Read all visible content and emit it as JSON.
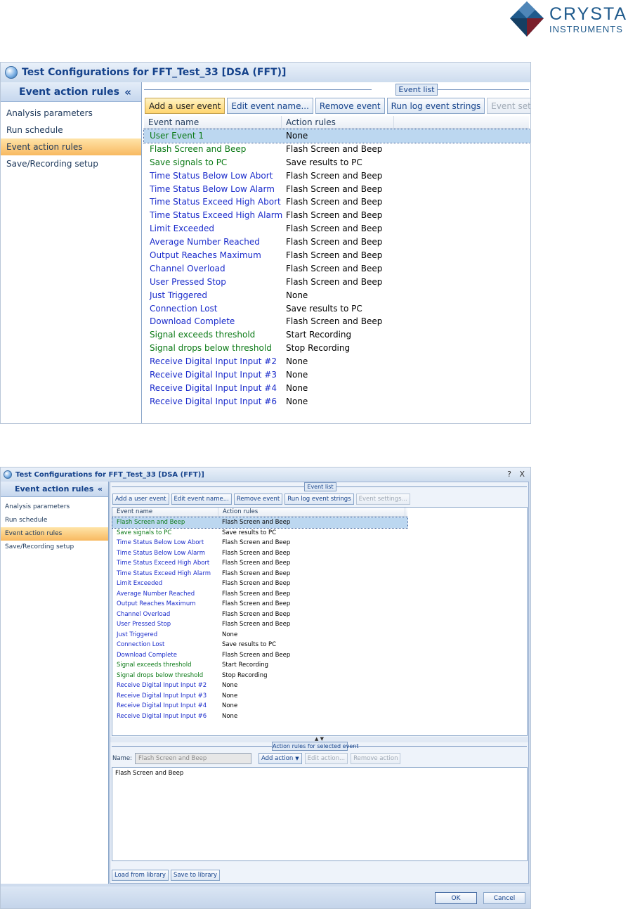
{
  "logo": {
    "line1": "CRYSTAL",
    "line2": "INSTRUMENTS",
    "colors": [
      "#1f5a8c",
      "#7a1f2b"
    ]
  },
  "window1": {
    "title": "Test Configurations for FFT_Test_33 [DSA (FFT)]",
    "sidebar": {
      "header": "Event action rules",
      "collapse_icon": "«",
      "items": [
        {
          "label": "Analysis parameters",
          "active": false
        },
        {
          "label": "Run schedule",
          "active": false
        },
        {
          "label": "Event action rules",
          "active": true
        },
        {
          "label": "Save/Recording setup",
          "active": false
        }
      ]
    },
    "group_title": "Event list",
    "toolbar": {
      "add": "Add a user event",
      "edit": "Edit event name...",
      "remove": "Remove event",
      "runlog": "Run log event strings",
      "settings": "Event settings..."
    },
    "columns": {
      "name": "Event name",
      "rules": "Action rules"
    },
    "rows": [
      {
        "name": "User Event 1",
        "rules": "None"
      },
      {
        "name": "Flash Screen and Beep",
        "rules": "Flash Screen and Beep"
      },
      {
        "name": "Save signals to PC",
        "rules": "Save results to PC"
      },
      {
        "name": "Time Status Below Low Abort",
        "rules": "Flash Screen and Beep"
      },
      {
        "name": "Time Status Below Low Alarm",
        "rules": "Flash Screen and Beep"
      },
      {
        "name": "Time Status Exceed High Abort",
        "rules": "Flash Screen and Beep"
      },
      {
        "name": "Time Status Exceed High Alarm",
        "rules": "Flash Screen and Beep"
      },
      {
        "name": "Limit Exceeded",
        "rules": "Flash Screen and Beep"
      },
      {
        "name": "Average Number Reached",
        "rules": "Flash Screen and Beep"
      },
      {
        "name": "Output Reaches Maximum",
        "rules": "Flash Screen and Beep"
      },
      {
        "name": "Channel Overload",
        "rules": "Flash Screen and Beep"
      },
      {
        "name": "User Pressed Stop",
        "rules": "Flash Screen and Beep"
      },
      {
        "name": "Just Triggered",
        "rules": "None"
      },
      {
        "name": "Connection Lost",
        "rules": "Save results to PC"
      },
      {
        "name": "Download Complete",
        "rules": "Flash Screen and Beep"
      },
      {
        "name": "Signal exceeds threshold",
        "rules": "Start Recording"
      },
      {
        "name": "Signal drops below threshold",
        "rules": "Stop Recording"
      },
      {
        "name": "Receive Digital Input Input #2",
        "rules": "None"
      },
      {
        "name": "Receive Digital Input Input #3",
        "rules": "None"
      },
      {
        "name": "Receive Digital Input Input #4",
        "rules": "None"
      },
      {
        "name": "Receive Digital Input Input #6",
        "rules": "None"
      }
    ]
  },
  "window2": {
    "title": "Test Configurations for FFT_Test_33 [DSA (FFT)]",
    "controls": {
      "help": "?",
      "close": "X"
    },
    "sidebar": {
      "header": "Event action rules",
      "collapse_icon": "«",
      "items": [
        {
          "label": "Analysis parameters",
          "active": false
        },
        {
          "label": "Run schedule",
          "active": false
        },
        {
          "label": "Event action rules",
          "active": true
        },
        {
          "label": "Save/Recording setup",
          "active": false
        }
      ]
    },
    "group_title": "Event list",
    "toolbar": {
      "add": "Add a user event",
      "edit": "Edit event name...",
      "remove": "Remove event",
      "runlog": "Run log event strings",
      "settings": "Event settings..."
    },
    "columns": {
      "name": "Event name",
      "rules": "Action rules"
    },
    "rows": [
      {
        "name": "Flash Screen and Beep",
        "rules": "Flash Screen and Beep"
      },
      {
        "name": "Save signals to PC",
        "rules": "Save results to PC"
      },
      {
        "name": "Time Status Below Low Abort",
        "rules": "Flash Screen and Beep"
      },
      {
        "name": "Time Status Below Low Alarm",
        "rules": "Flash Screen and Beep"
      },
      {
        "name": "Time Status Exceed High Abort",
        "rules": "Flash Screen and Beep"
      },
      {
        "name": "Time Status Exceed High Alarm",
        "rules": "Flash Screen and Beep"
      },
      {
        "name": "Limit Exceeded",
        "rules": "Flash Screen and Beep"
      },
      {
        "name": "Average Number Reached",
        "rules": "Flash Screen and Beep"
      },
      {
        "name": "Output Reaches Maximum",
        "rules": "Flash Screen and Beep"
      },
      {
        "name": "Channel Overload",
        "rules": "Flash Screen and Beep"
      },
      {
        "name": "User Pressed Stop",
        "rules": "Flash Screen and Beep"
      },
      {
        "name": "Just Triggered",
        "rules": "None"
      },
      {
        "name": "Connection Lost",
        "rules": "Save results to PC"
      },
      {
        "name": "Download Complete",
        "rules": "Flash Screen and Beep"
      },
      {
        "name": "Signal exceeds threshold",
        "rules": "Start Recording"
      },
      {
        "name": "Signal drops below threshold",
        "rules": "Stop Recording"
      },
      {
        "name": "Receive Digital Input Input #2",
        "rules": "None"
      },
      {
        "name": "Receive Digital Input Input #3",
        "rules": "None"
      },
      {
        "name": "Receive Digital Input Input #4",
        "rules": "None"
      },
      {
        "name": "Receive Digital Input Input #6",
        "rules": "None"
      }
    ],
    "action_group_title": "Action rules for selected event",
    "name_label": "Name:",
    "name_value": "Flash Screen and Beep",
    "action_buttons": {
      "add": "Add action",
      "edit": "Edit action...",
      "remove": "Remove action"
    },
    "actions_text": "Flash Screen and Beep",
    "library": {
      "load": "Load from library",
      "save": "Save to library"
    },
    "ok": "OK",
    "cancel": "Cancel"
  }
}
